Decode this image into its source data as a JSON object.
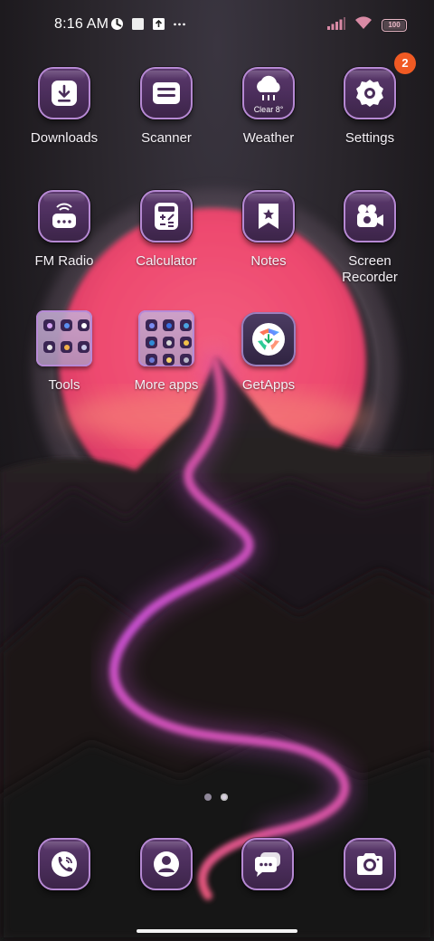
{
  "status": {
    "time": "8:16 AM",
    "battery": "100"
  },
  "apps": {
    "downloads": "Downloads",
    "scanner": "Scanner",
    "weather": "Weather",
    "weather_sub": "Clear 8°",
    "settings": "Settings",
    "settings_badge": "2",
    "fm_radio": "FM Radio",
    "calculator": "Calculator",
    "notes": "Notes",
    "screen_recorder": "Screen Recorder",
    "tools": "Tools",
    "more_apps": "More apps",
    "getapps": "GetApps"
  },
  "dock": {
    "icons": [
      "phone-icon",
      "contacts-icon",
      "messages-icon",
      "camera-icon"
    ]
  },
  "page_indicator": {
    "count": 2,
    "active": 2
  },
  "colors": {
    "tile_border": "#b689d3",
    "badge": "#f05a23",
    "sun": "#ef4a72",
    "river": "#d54bd8"
  }
}
